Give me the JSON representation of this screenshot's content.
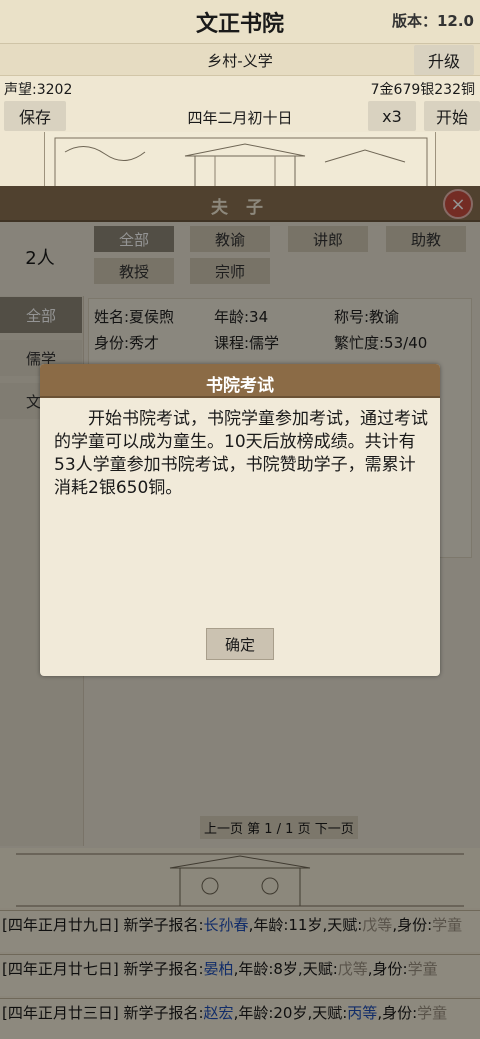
{
  "header": {
    "title": "文正书院",
    "version": "版本：12.0"
  },
  "subheader": {
    "title": "乡村-义学",
    "upgrade_label": "升级"
  },
  "stats": {
    "reputation": "声望:3202",
    "money": "7金679银232铜"
  },
  "toolbar": {
    "save_label": "保存",
    "date": "四年二月初十日",
    "speed_label": "x3",
    "start_label": "开始"
  },
  "staff_panel": {
    "title": "夫 子",
    "close_icon": "×",
    "count": "2人",
    "filter_tabs": [
      "全部",
      "教谕",
      "讲郎",
      "助教",
      "教授",
      "宗师"
    ],
    "side_tabs": [
      "全部",
      "儒学",
      "文"
    ],
    "teacher": {
      "name": "姓名:夏侯煦",
      "age": "年龄:34",
      "title": "称号:教谕",
      "status": "身份:秀才",
      "course": "课程:儒学",
      "busy": "繁忙度:53/40"
    },
    "pager": "上一页 第 1 / 1 页 下一页"
  },
  "logs": [
    {
      "date": "[四年正月廿九日]",
      "text_a": " 新学子报名:",
      "name": "长孙春",
      "text_b": ",年龄:11岁,天赋:",
      "talent": "戊等",
      "text_c": ",身份:",
      "identity": "学童"
    },
    {
      "date": "[四年正月廿七日]",
      "text_a": " 新学子报名:",
      "name": "晏柏",
      "text_b": ",年龄:8岁,天赋:",
      "talent": "戊等",
      "text_c": ",身份:",
      "identity": "学童"
    },
    {
      "date": "[四年正月廿三日]",
      "text_a": " 新学子报名:",
      "name": "赵宏",
      "text_b": ",年龄:20岁,天赋:",
      "talent": "丙等",
      "text_c": ",身份:",
      "identity": "学童"
    }
  ],
  "modal": {
    "title": "书院考试",
    "body": "开始书院考试，书院学童参加考试，通过考试的学童可以成为童生。10天后放榜成绩。共计有53人学童参加书院考试，书院赞助学子，需累计消耗2银650铜。",
    "confirm_label": "确定"
  }
}
